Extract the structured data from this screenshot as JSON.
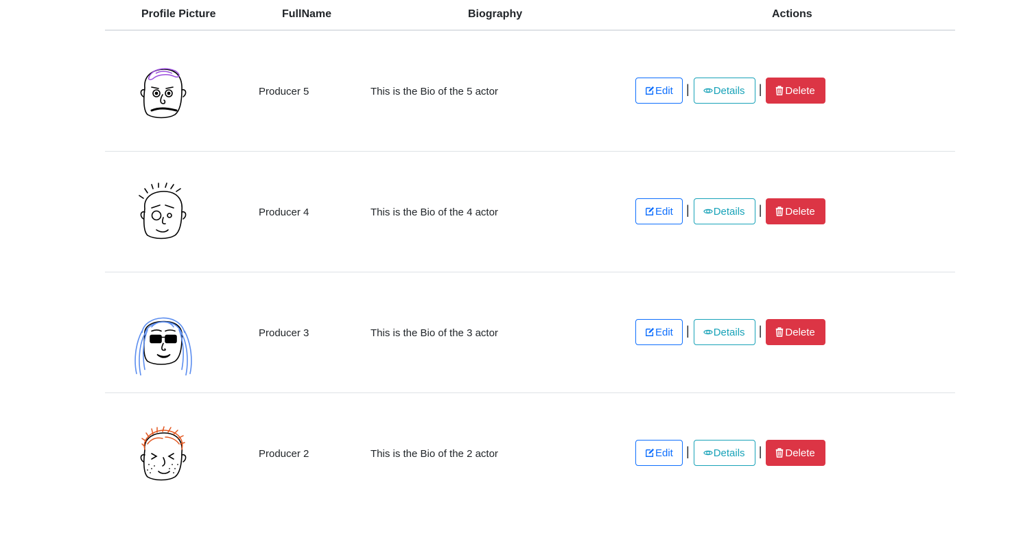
{
  "table": {
    "headers": {
      "picture": "Profile Picture",
      "fullname": "FullName",
      "biography": "Biography",
      "actions": "Actions"
    },
    "rows": [
      {
        "avatar": "bald-mustache-avatar",
        "name": "Producer 5",
        "bio": "This is the Bio of the 5 actor"
      },
      {
        "avatar": "spiky-hair-monocle-avatar",
        "name": "Producer 4",
        "bio": "This is the Bio of the 4 actor"
      },
      {
        "avatar": "long-hair-sunglasses-avatar",
        "name": "Producer 3",
        "bio": "This is the Bio of the 3 actor"
      },
      {
        "avatar": "red-hair-freckles-avatar",
        "name": "Producer 2",
        "bio": "This is the Bio of the 2 actor"
      }
    ]
  },
  "buttons": {
    "edit": "Edit",
    "details": "Details",
    "delete": "Delete",
    "separator": "|"
  },
  "colors": {
    "primary": "#0d6efd",
    "info": "#17a2b8",
    "danger": "#dc3545",
    "border": "#dee2e6"
  }
}
